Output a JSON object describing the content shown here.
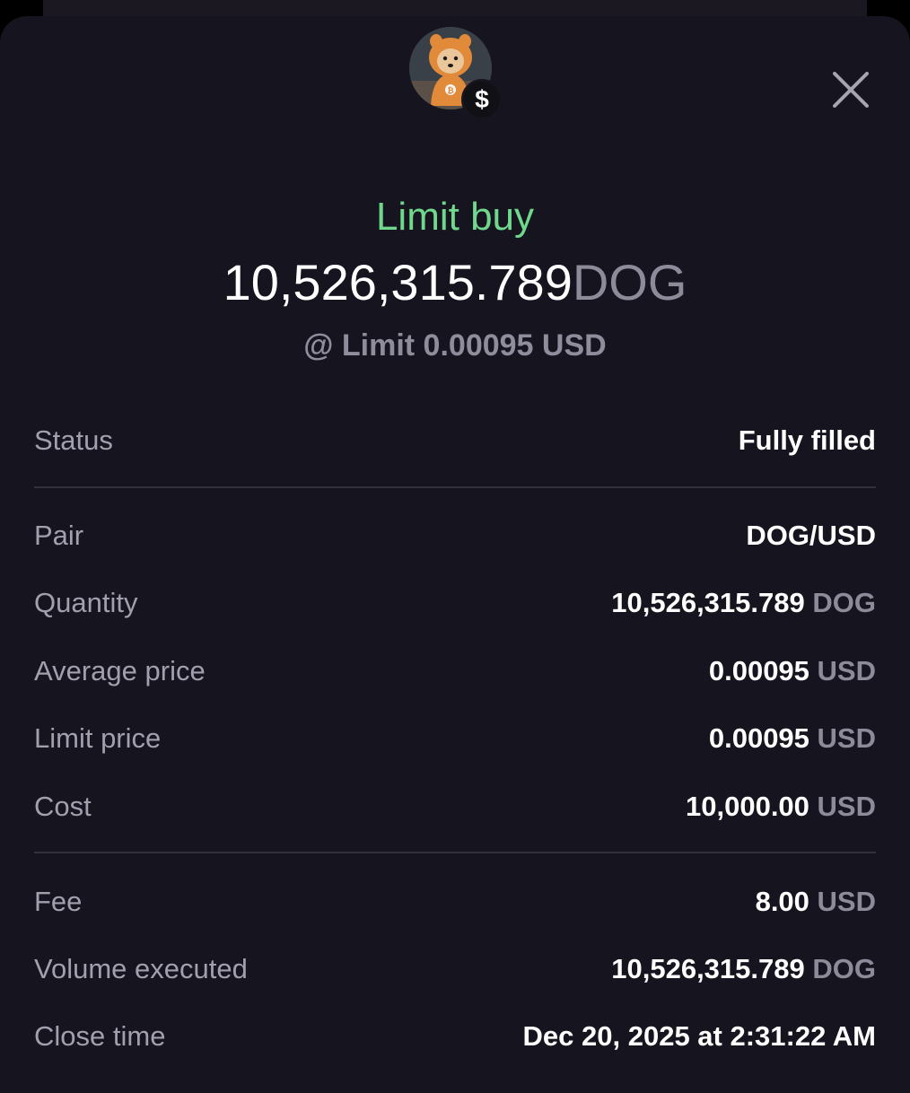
{
  "header": {
    "order_type": "Limit buy",
    "amount": "10,526,315.789",
    "amount_unit": "DOG",
    "limit_line": "@ Limit 0.00095 USD",
    "badge_symbol": "$"
  },
  "icons": {
    "close": "close-icon",
    "badge": "dollar-icon",
    "avatar": "dog-avatar"
  },
  "details": {
    "status": {
      "label": "Status",
      "value": "Fully filled"
    },
    "pair": {
      "label": "Pair",
      "value": "DOG/USD"
    },
    "quantity": {
      "label": "Quantity",
      "value": "10,526,315.789",
      "unit": "DOG"
    },
    "average_price": {
      "label": "Average price",
      "value": "0.00095",
      "unit": "USD"
    },
    "limit_price": {
      "label": "Limit price",
      "value": "0.00095",
      "unit": "USD"
    },
    "cost": {
      "label": "Cost",
      "value": "10,000.00",
      "unit": "USD"
    },
    "fee": {
      "label": "Fee",
      "value": "8.00",
      "unit": "USD"
    },
    "volume_executed": {
      "label": "Volume executed",
      "value": "10,526,315.789",
      "unit": "DOG"
    },
    "close_time": {
      "label": "Close time",
      "value": "Dec 20, 2025 at 2:31:22 AM"
    }
  },
  "colors": {
    "accent_green": "#6fd88c",
    "background": "#16141e",
    "muted": "#8d8a9a"
  }
}
